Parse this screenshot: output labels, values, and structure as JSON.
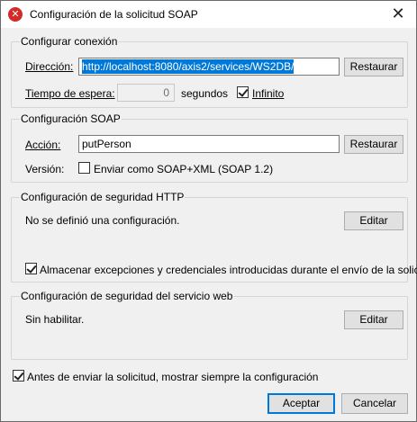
{
  "window": {
    "title": "Configuración de la solicitud SOAP",
    "close_glyph": "✕",
    "icon_glyph": "✕"
  },
  "connection": {
    "group_title": "Configurar conexión",
    "address_label": "Dirección:",
    "address_value": "http://localhost:8080/axis2/services/WS2DB/",
    "restore_label": "Restaurar",
    "timeout_label": "Tiempo de espera:",
    "timeout_value": "0",
    "seconds_label": "segundos",
    "infinite_label": "Infinito",
    "infinite_checked": true
  },
  "soap": {
    "group_title": "Configuración SOAP",
    "action_label": "Acción:",
    "action_value": "putPerson",
    "restore_label": "Restaurar",
    "version_label": "Versión:",
    "soap12_label": "Enviar como SOAP+XML (SOAP 1.2)",
    "soap12_checked": false
  },
  "http_security": {
    "group_title": "Configuración de seguridad HTTP",
    "status_text": "No se definió una configuración.",
    "edit_label": "Editar",
    "store_label": "Almacenar excepciones y credenciales introducidas durante el envío de la solicitud",
    "store_checked": true
  },
  "ws_security": {
    "group_title": "Configuración de seguridad del servicio web",
    "status_text": "Sin habilitar.",
    "edit_label": "Editar"
  },
  "footer": {
    "always_show_label": "Antes de enviar la solicitud, mostrar siempre la configuración",
    "always_show_checked": true,
    "accept_label": "Aceptar",
    "cancel_label": "Cancelar"
  }
}
